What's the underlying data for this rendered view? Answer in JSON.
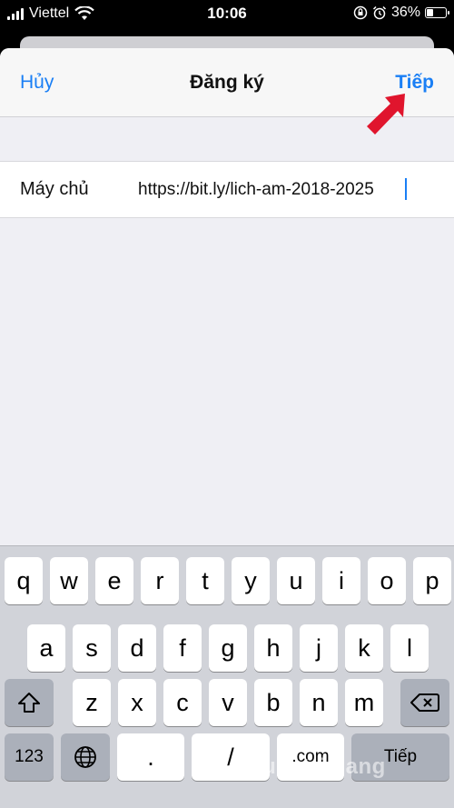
{
  "status_bar": {
    "carrier": "Viettel",
    "time": "10:06",
    "battery": "36%",
    "battery_fraction": 0.36
  },
  "header": {
    "cancel_label": "Hủy",
    "title": "Đăng ký",
    "next_label": "Tiếp"
  },
  "form": {
    "server_label": "Máy chủ",
    "server_value": "https://bit.ly/lich-am-2018-2025"
  },
  "keyboard": {
    "row1": [
      "q",
      "w",
      "e",
      "r",
      "t",
      "y",
      "u",
      "i",
      "o",
      "p"
    ],
    "row2": [
      "a",
      "s",
      "d",
      "f",
      "g",
      "h",
      "j",
      "k",
      "l"
    ],
    "row3": [
      "z",
      "x",
      "c",
      "v",
      "b",
      "n",
      "m"
    ],
    "numbers_label": "123",
    "dot_label": ".",
    "slash_label": "/",
    "dotcom_label": ".com",
    "return_label": "Tiếp"
  },
  "watermark": "Quantrimang",
  "colors": {
    "accent": "#1a7ff5",
    "arrow": "#e0152d"
  }
}
